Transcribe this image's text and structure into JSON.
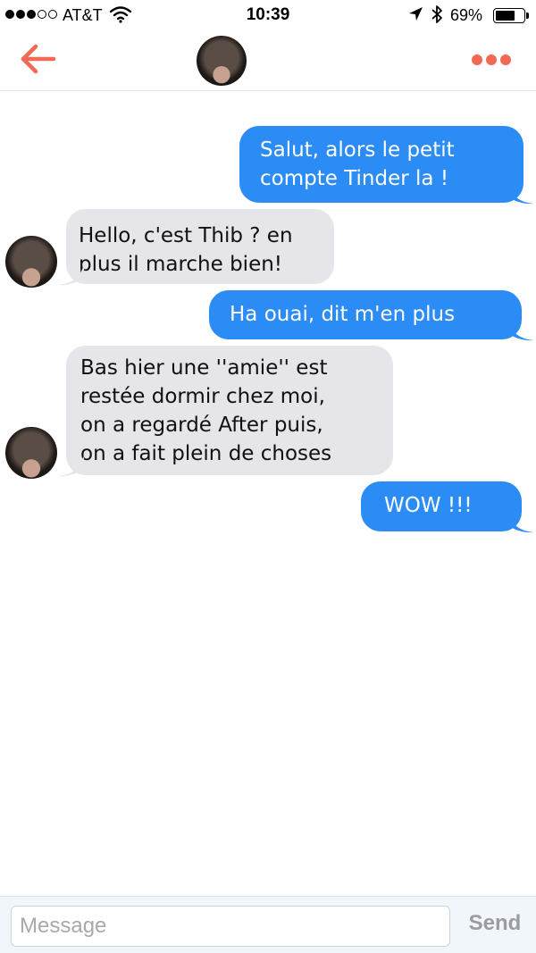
{
  "status_bar": {
    "carrier": "AT&T",
    "signal_bars_filled": 3,
    "signal_bars_total": 5,
    "time": "10:39",
    "battery_percent": "69%",
    "battery_level": 0.69
  },
  "header": {
    "back_icon": "arrow-left-icon",
    "more_icon": "more-dots-icon",
    "accent_color": "#f26a55"
  },
  "messages": [
    {
      "direction": "outgoing",
      "text": "Salut, alors le petit\ncompte Tinder la !"
    },
    {
      "direction": "incoming",
      "text": "Hello, c'est Thib ? en\nplus il marche bien!"
    },
    {
      "direction": "outgoing",
      "text": "Ha ouai, dit m'en plus"
    },
    {
      "direction": "incoming",
      "text": "Bas hier une ''amie'' est\nrestée dormir chez moi,\non a regardé After puis,\non a fait plein de choses"
    },
    {
      "direction": "outgoing",
      "text": "WOW !!!"
    }
  ],
  "colors": {
    "outgoing_bubble": "#2b8cf5",
    "incoming_bubble": "#e5e5ea"
  },
  "composer": {
    "placeholder": "Message",
    "value": "",
    "send_label": "Send"
  }
}
